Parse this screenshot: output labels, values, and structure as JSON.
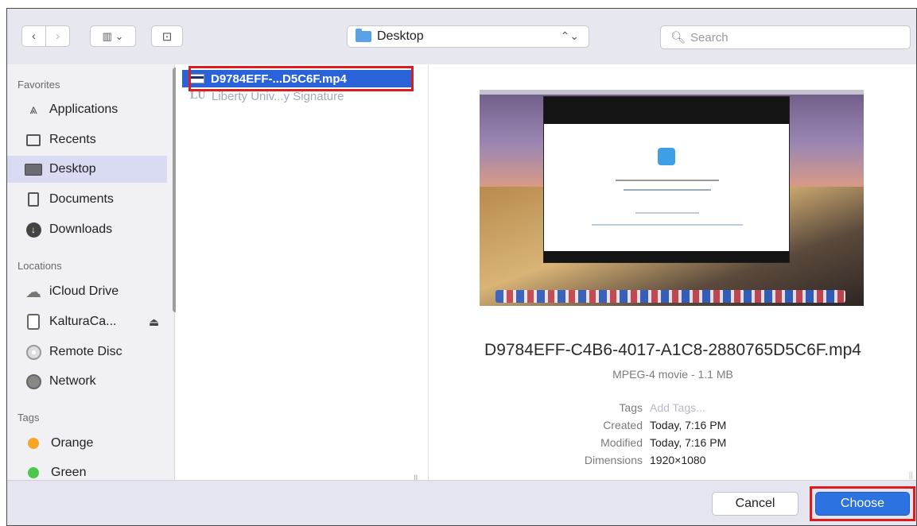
{
  "toolbar": {
    "back_glyph": "‹",
    "forward_glyph": "›",
    "view_glyph": "▥ ⌄",
    "new_folder_glyph": "⊡",
    "location": "Desktop",
    "location_arrows": "⌃⌄",
    "search_placeholder": "Search"
  },
  "sidebar": {
    "favorites_header": "Favorites",
    "favorites": [
      {
        "label": "Applications",
        "icon": "applications-icon"
      },
      {
        "label": "Recents",
        "icon": "recents-icon"
      },
      {
        "label": "Desktop",
        "icon": "desktop-icon",
        "selected": true
      },
      {
        "label": "Documents",
        "icon": "documents-icon"
      },
      {
        "label": "Downloads",
        "icon": "downloads-icon"
      }
    ],
    "locations_header": "Locations",
    "locations": [
      {
        "label": "iCloud Drive",
        "icon": "cloud-icon"
      },
      {
        "label": "KalturaCa...",
        "icon": "drive-icon",
        "eject": "⏏"
      },
      {
        "label": "Remote Disc",
        "icon": "disc-icon"
      },
      {
        "label": "Network",
        "icon": "globe-icon"
      }
    ],
    "tags_header": "Tags",
    "tags": [
      {
        "label": "Orange",
        "color": "#f5a623"
      },
      {
        "label": "Green",
        "color": "#4cc94c"
      }
    ]
  },
  "file_list": [
    {
      "name": "D9784EFF-...D5C6F.mp4",
      "selected": true
    },
    {
      "name": "Liberty Univ...y Signature",
      "dimmed": true,
      "icon_text": "LU"
    }
  ],
  "preview": {
    "filename": "D9784EFF-C4B6-4017-A1C8-2880765D5C6F.mp4",
    "kind": "MPEG-4 movie - 1.1 MB",
    "thumb_logo": "LU",
    "meta": [
      {
        "label": "Tags",
        "value": "Add Tags...",
        "placeholder": true
      },
      {
        "label": "Created",
        "value": "Today, 7:16 PM"
      },
      {
        "label": "Modified",
        "value": "Today, 7:16 PM"
      },
      {
        "label": "Dimensions",
        "value": "1920×1080"
      }
    ]
  },
  "footer": {
    "cancel_label": "Cancel",
    "choose_label": "Choose"
  },
  "colors": {
    "accent": "#2c72e0",
    "selection": "#2a63d8",
    "highlight_annotation": "#e01b1b"
  }
}
